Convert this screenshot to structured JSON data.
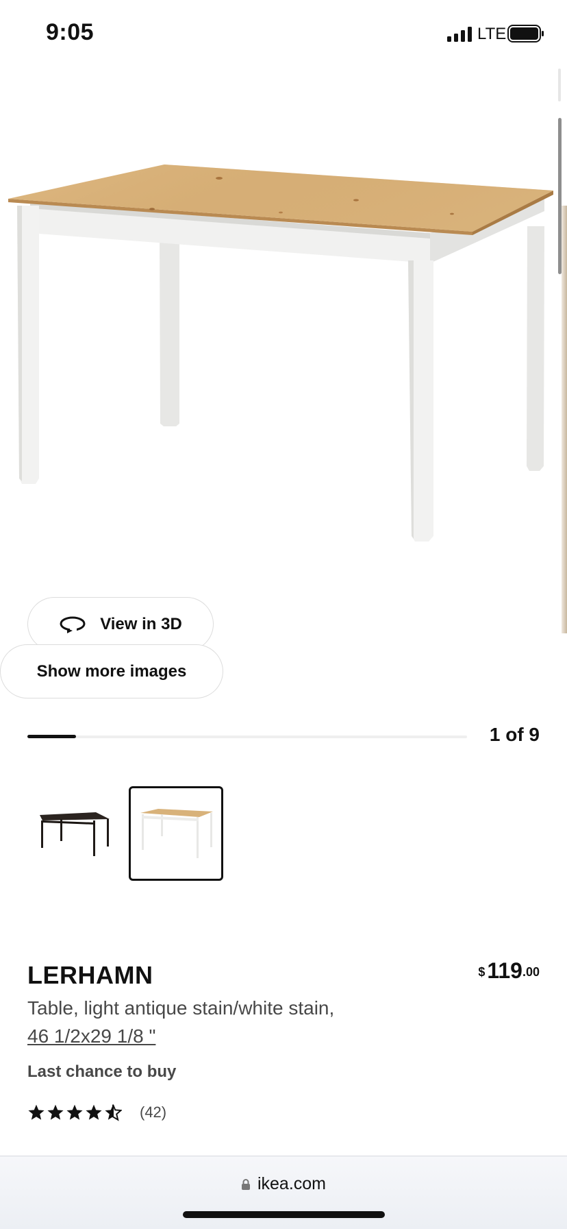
{
  "status_bar": {
    "time": "9:05",
    "network": "LTE"
  },
  "gallery": {
    "view3d_label": "View in 3D",
    "show_more_label": "Show more images",
    "page_counter": "1 of 9",
    "progress_fraction": 0.11
  },
  "variants": [
    {
      "name": "black-brown",
      "selected": false
    },
    {
      "name": "light antique stain/white stain",
      "selected": true
    }
  ],
  "product": {
    "name": "LERHAMN",
    "description_line1": "Table, light antique stain/white stain,",
    "description_line2": "46 1/2x29 1/8 \"",
    "price_currency": "$",
    "price_main": "119",
    "price_cents": ".00",
    "notice": "Last chance to buy",
    "rating_stars": 4.5,
    "rating_count": "(42)"
  },
  "browser": {
    "url": "ikea.com"
  },
  "colors": {
    "accent": "#111111",
    "wood": "#d4ac73",
    "white_stain": "#f0f0ef"
  }
}
